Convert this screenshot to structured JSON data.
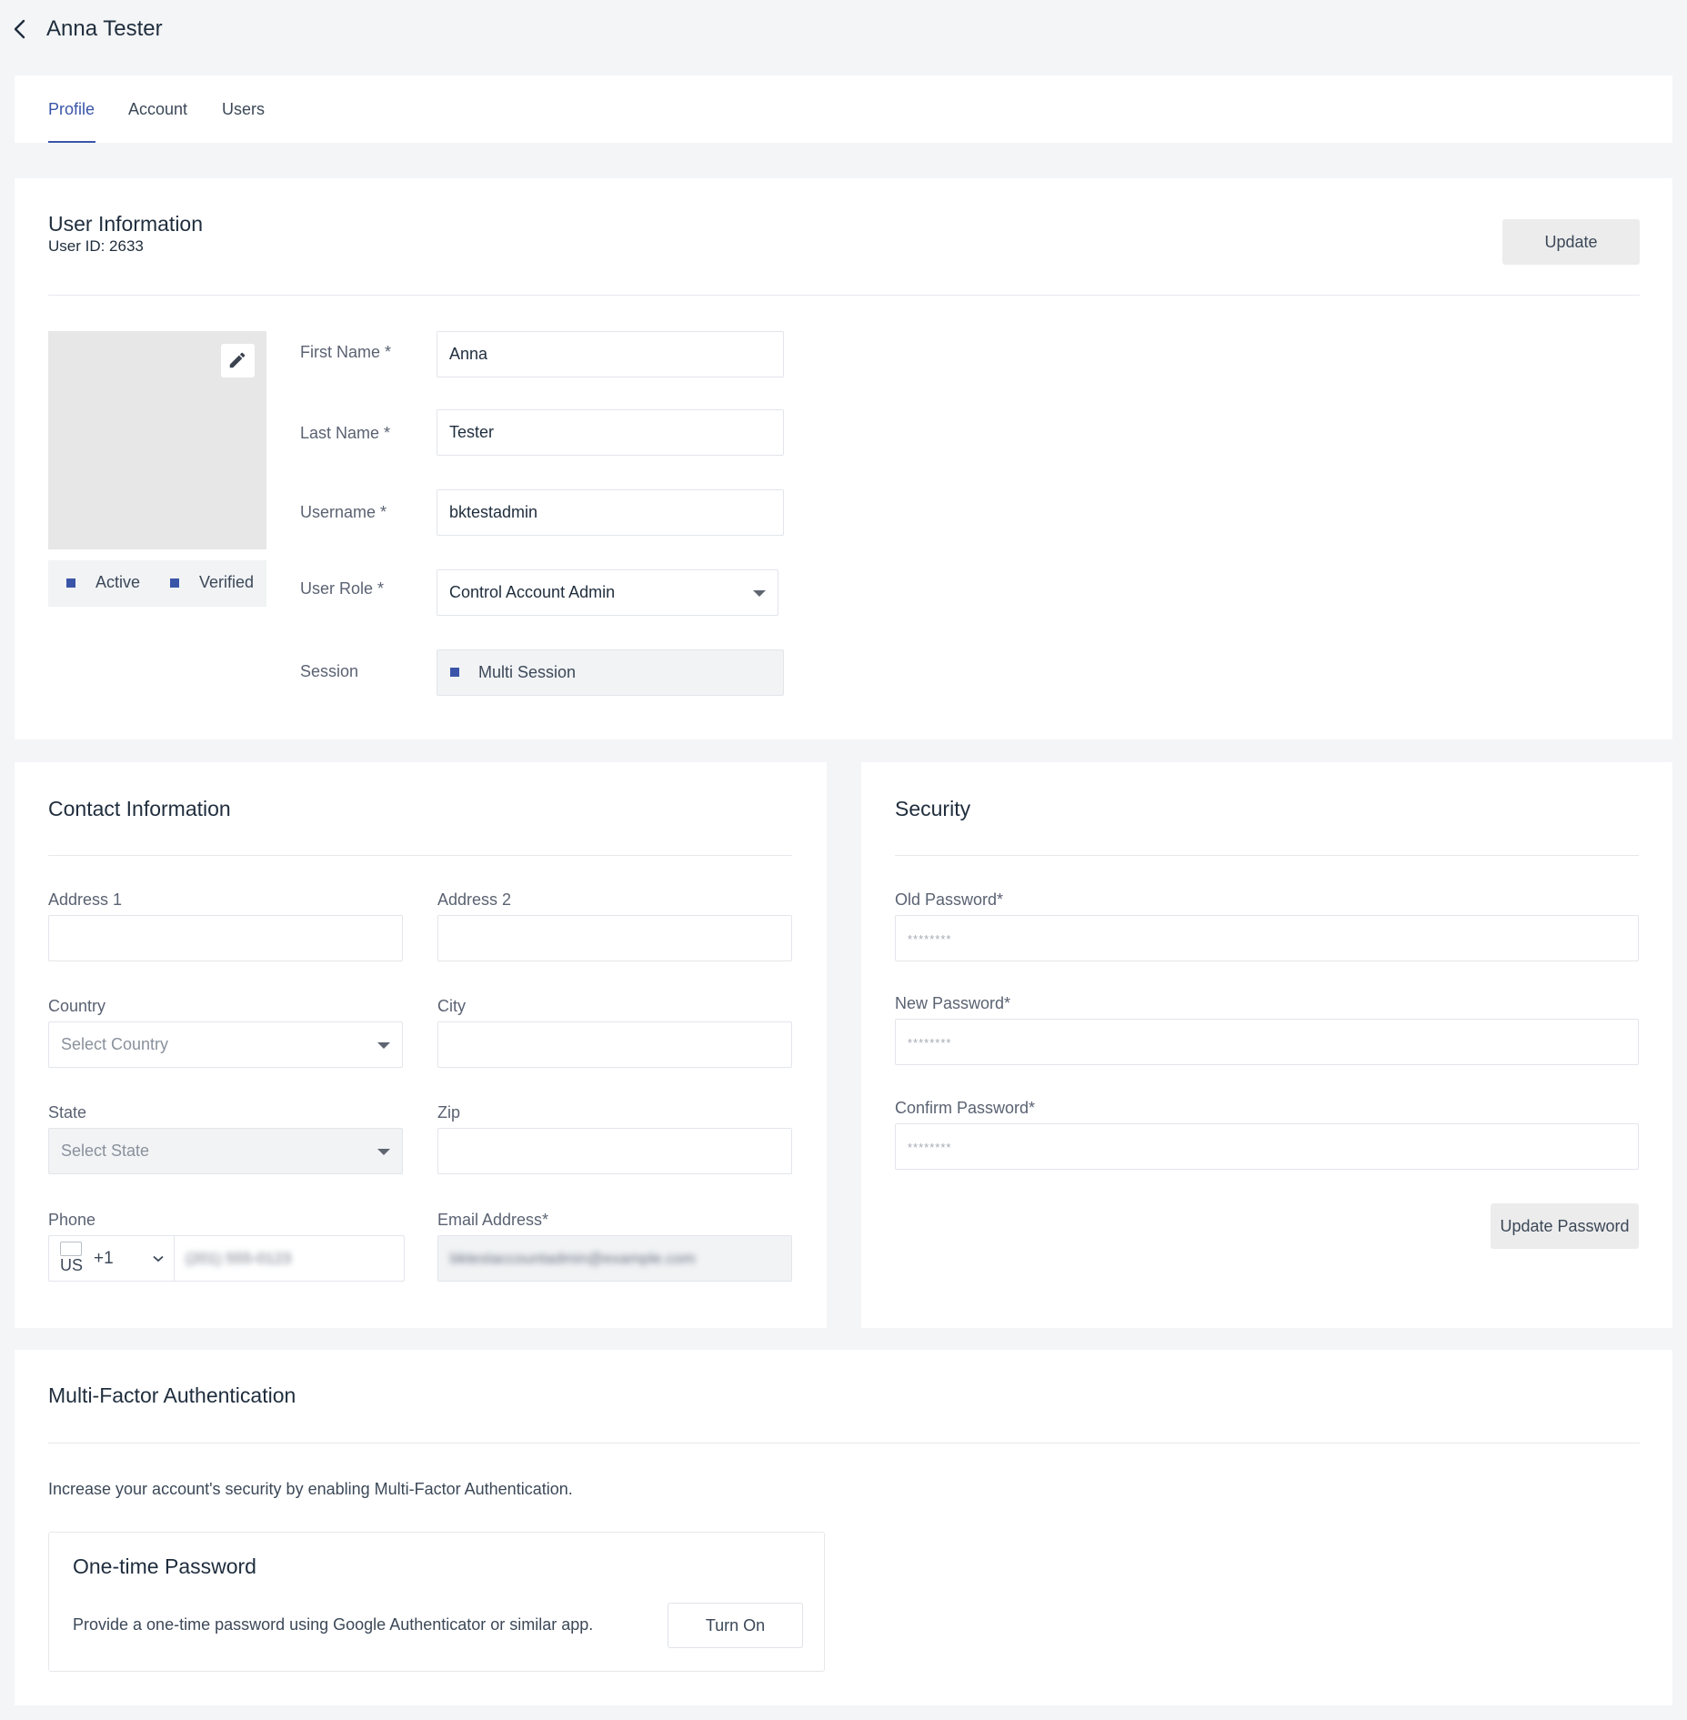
{
  "header": {
    "title": "Anna Tester"
  },
  "tabs": [
    {
      "label": "Profile",
      "active": true
    },
    {
      "label": "Account",
      "active": false
    },
    {
      "label": "Users",
      "active": false
    }
  ],
  "user_info": {
    "title": "User Information",
    "user_id": "User ID: 2633",
    "update_label": "Update",
    "status": {
      "active_label": "Active",
      "verified_label": "Verified"
    },
    "fields": {
      "first_name": {
        "label": "First Name *",
        "value": "Anna"
      },
      "last_name": {
        "label": "Last Name *",
        "value": "Tester"
      },
      "username": {
        "label": "Username *",
        "value": "bktestadmin"
      },
      "user_role": {
        "label": "User Role *",
        "value": "Control Account Admin"
      },
      "session": {
        "label": "Session",
        "value": "Multi Session"
      }
    }
  },
  "contact": {
    "title": "Contact Information",
    "address1": {
      "label": "Address 1",
      "value": ""
    },
    "address2": {
      "label": "Address 2",
      "value": ""
    },
    "country": {
      "label": "Country",
      "placeholder": "Select Country"
    },
    "city": {
      "label": "City",
      "value": ""
    },
    "state": {
      "label": "State",
      "placeholder": "Select State"
    },
    "zip": {
      "label": "Zip",
      "value": ""
    },
    "phone": {
      "label": "Phone",
      "flag_alt": "US",
      "code": "+1",
      "value": "(201) 555-0123"
    },
    "email": {
      "label": "Email Address*",
      "value": "bktestaccountadmin@example.com"
    }
  },
  "security": {
    "title": "Security",
    "old_password": {
      "label": "Old Password*",
      "placeholder": "********"
    },
    "new_password": {
      "label": "New Password*",
      "placeholder": "********"
    },
    "confirm_password": {
      "label": "Confirm Password*",
      "placeholder": "********"
    },
    "update_password_label": "Update Password"
  },
  "mfa": {
    "title": "Multi-Factor Authentication",
    "description": "Increase your account's security by enabling Multi-Factor Authentication.",
    "otp": {
      "title": "One-time Password",
      "description": "Provide a one-time password using Google Authenticator or similar app.",
      "button_label": "Turn On"
    }
  },
  "colors": {
    "accent": "#3a55a8",
    "background": "#f4f5f7",
    "card": "#ffffff"
  },
  "icons": [
    "back-arrow-icon",
    "pencil-icon",
    "caret-down-icon",
    "chevron-down-icon",
    "us-flag-icon"
  ]
}
